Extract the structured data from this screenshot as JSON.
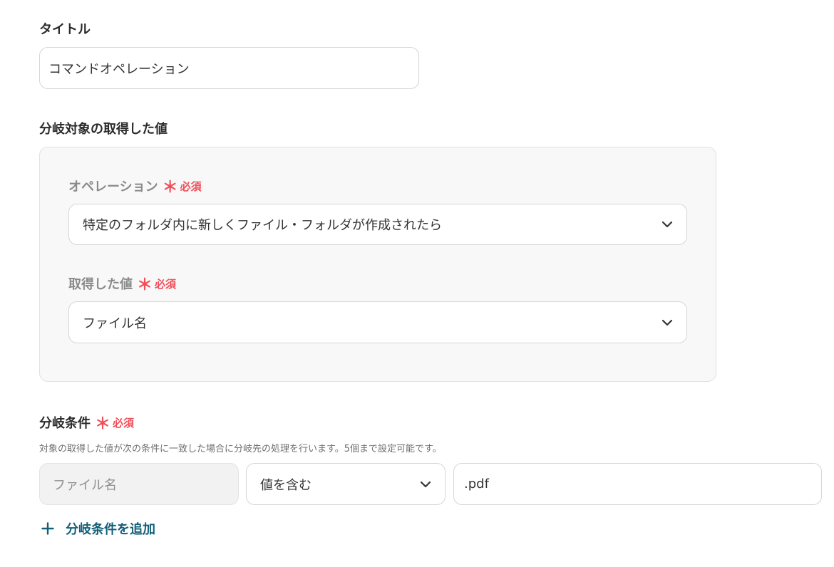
{
  "title_field": {
    "label": "タイトル",
    "value": "コマンドオペレーション"
  },
  "branch_target": {
    "label": "分岐対象の取得した値",
    "operation": {
      "label": "オペレーション",
      "required_mark": "＊",
      "required_text": "必須",
      "selected": "特定のフォルダ内に新しくファイル・フォルダが作成されたら"
    },
    "acquired_value": {
      "label": "取得した値",
      "required_mark": "＊",
      "required_text": "必須",
      "selected": "ファイル名"
    }
  },
  "branch_condition": {
    "label": "分岐条件",
    "required_mark": "＊",
    "required_text": "必須",
    "description": "対象の取得した値が次の条件に一致した場合に分岐先の処理を行います。5個まで設定可能です。",
    "row": {
      "field": "ファイル名",
      "operator": "値を含む",
      "value": ".pdf"
    },
    "add_label": "分岐条件を追加"
  },
  "colors": {
    "required": "#f04e59",
    "link": "#13607a",
    "border": "#d6d6d6",
    "panel_bg": "#f8f8f8"
  },
  "icons": {
    "dropdown": "chevron-down-icon",
    "add": "plus-icon"
  }
}
